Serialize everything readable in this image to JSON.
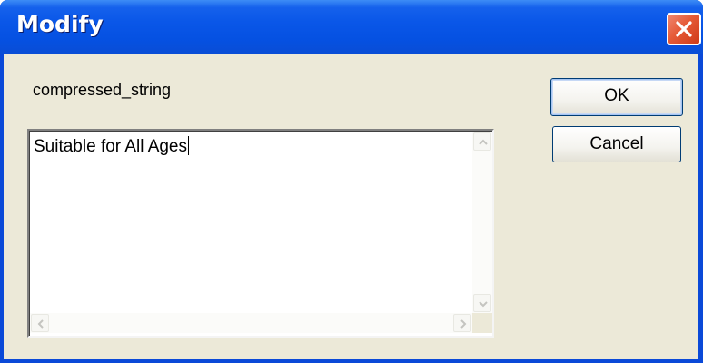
{
  "window": {
    "title": "Modify"
  },
  "field": {
    "name": "compressed_string",
    "value": "Suitable for All Ages"
  },
  "buttons": {
    "ok": "OK",
    "cancel": "Cancel"
  },
  "icons": {
    "close": "close-icon",
    "scroll_up": "chevron-up-icon",
    "scroll_down": "chevron-down-icon",
    "scroll_left": "chevron-left-icon",
    "scroll_right": "chevron-right-icon"
  },
  "colors": {
    "titlebar": "#0a57e8",
    "dialog_face": "#ece9d8",
    "close_button": "#e55a37"
  }
}
